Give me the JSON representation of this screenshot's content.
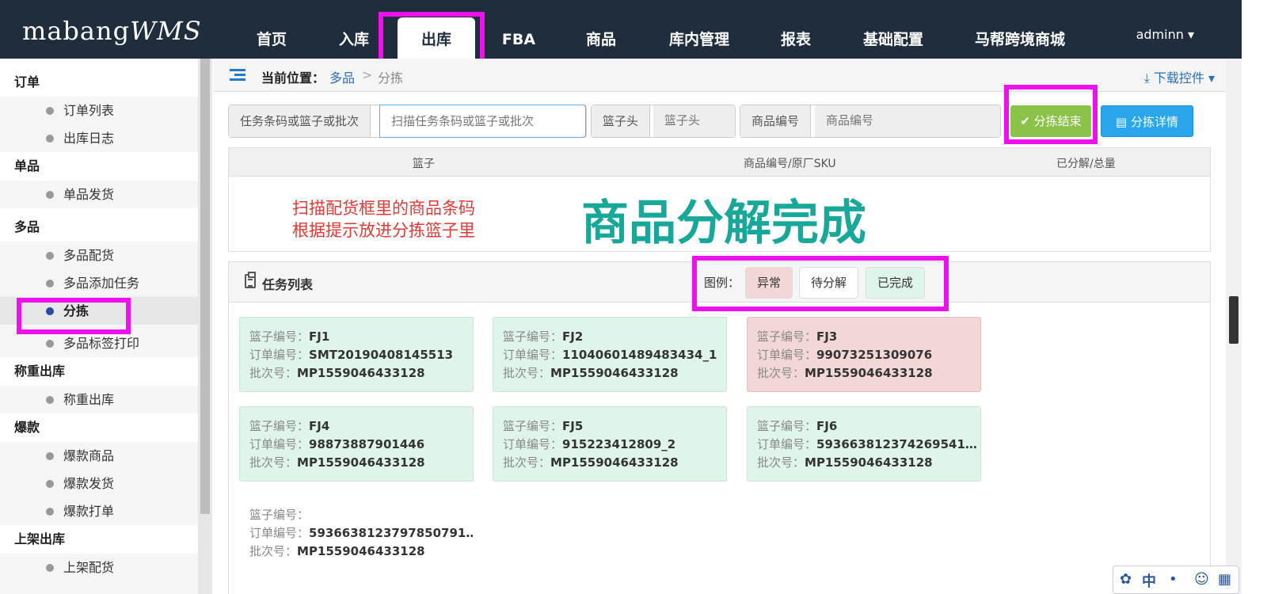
{
  "app": {
    "logo_text": "mabang",
    "logo_suffix": "WMS"
  },
  "nav": {
    "items": [
      "首页",
      "入库",
      "出库",
      "FBA",
      "商品",
      "库内管理",
      "报表",
      "基础配置",
      "马帮跨境商城"
    ],
    "active": "出库",
    "user": "adminn"
  },
  "sidebar": {
    "groups": [
      {
        "title": "订单",
        "items": [
          "订单列表",
          "出库日志"
        ]
      },
      {
        "title": "单品",
        "items": [
          "单品发货"
        ]
      },
      {
        "title": "多品",
        "items": [
          "多品配货",
          "多品添加任务",
          "分拣",
          "多品标签打印"
        ]
      },
      {
        "title": "称重出库",
        "items": [
          "称重出库"
        ]
      },
      {
        "title": "爆款",
        "items": [
          "爆款商品",
          "爆款发货",
          "爆款打单"
        ]
      },
      {
        "title": "上架出库",
        "items": [
          "上架配货"
        ]
      }
    ],
    "active_item": "分拣"
  },
  "breadcrumb": {
    "label": "当前位置：",
    "parent": "多品",
    "separator": ">",
    "current": "分拣",
    "download": "下载控件"
  },
  "search": {
    "task_label": "任务条码或篮子或批次",
    "task_placeholder": "扫描任务条码或篮子或批次",
    "basket_label": "篮子头",
    "basket_placeholder": "篮子头",
    "sku_label": "商品编号",
    "sku_placeholder": "商品编号",
    "finish_button": "分拣结束",
    "detail_button": "分拣详情"
  },
  "result": {
    "columns": [
      "篮子",
      "商品编号/原厂SKU",
      "已分解/总量"
    ],
    "hint_line1": "扫描配货框里的商品条码",
    "hint_line2": "根据提示放进分拣篮子里",
    "done_message": "商品分解完成"
  },
  "tasks": {
    "title": "任务列表",
    "legend_label": "图例：",
    "legend": [
      {
        "label": "异常",
        "color": "#f3d7d7"
      },
      {
        "label": "待分解",
        "color": "#ffffff"
      },
      {
        "label": "已完成",
        "color": "#dff5ea"
      }
    ],
    "field_labels": {
      "basket": "篮子编号：",
      "order": "订单编号：",
      "batch": "批次号："
    },
    "cards": [
      {
        "basket": "FJ1",
        "order": "SMT20190408145513",
        "batch": "MP1559046433128",
        "status": "done"
      },
      {
        "basket": "FJ2",
        "order": "11040601489483434_1",
        "batch": "MP1559046433128",
        "status": "done"
      },
      {
        "basket": "FJ3",
        "order": "99073251309076",
        "batch": "MP1559046433128",
        "status": "error"
      },
      {
        "basket": "FJ4",
        "order": "98873887901446",
        "batch": "MP1559046433128",
        "status": "done"
      },
      {
        "basket": "FJ5",
        "order": "915223412809_2",
        "batch": "MP1559046433128",
        "status": "done"
      },
      {
        "basket": "FJ6",
        "order": "593663812374269541…",
        "batch": "MP1559046433128",
        "status": "done"
      },
      {
        "basket": "",
        "order": "5936638123797850791…",
        "batch": "MP1559046433128",
        "status": "pending"
      }
    ]
  },
  "ime": {
    "mode": "中"
  }
}
